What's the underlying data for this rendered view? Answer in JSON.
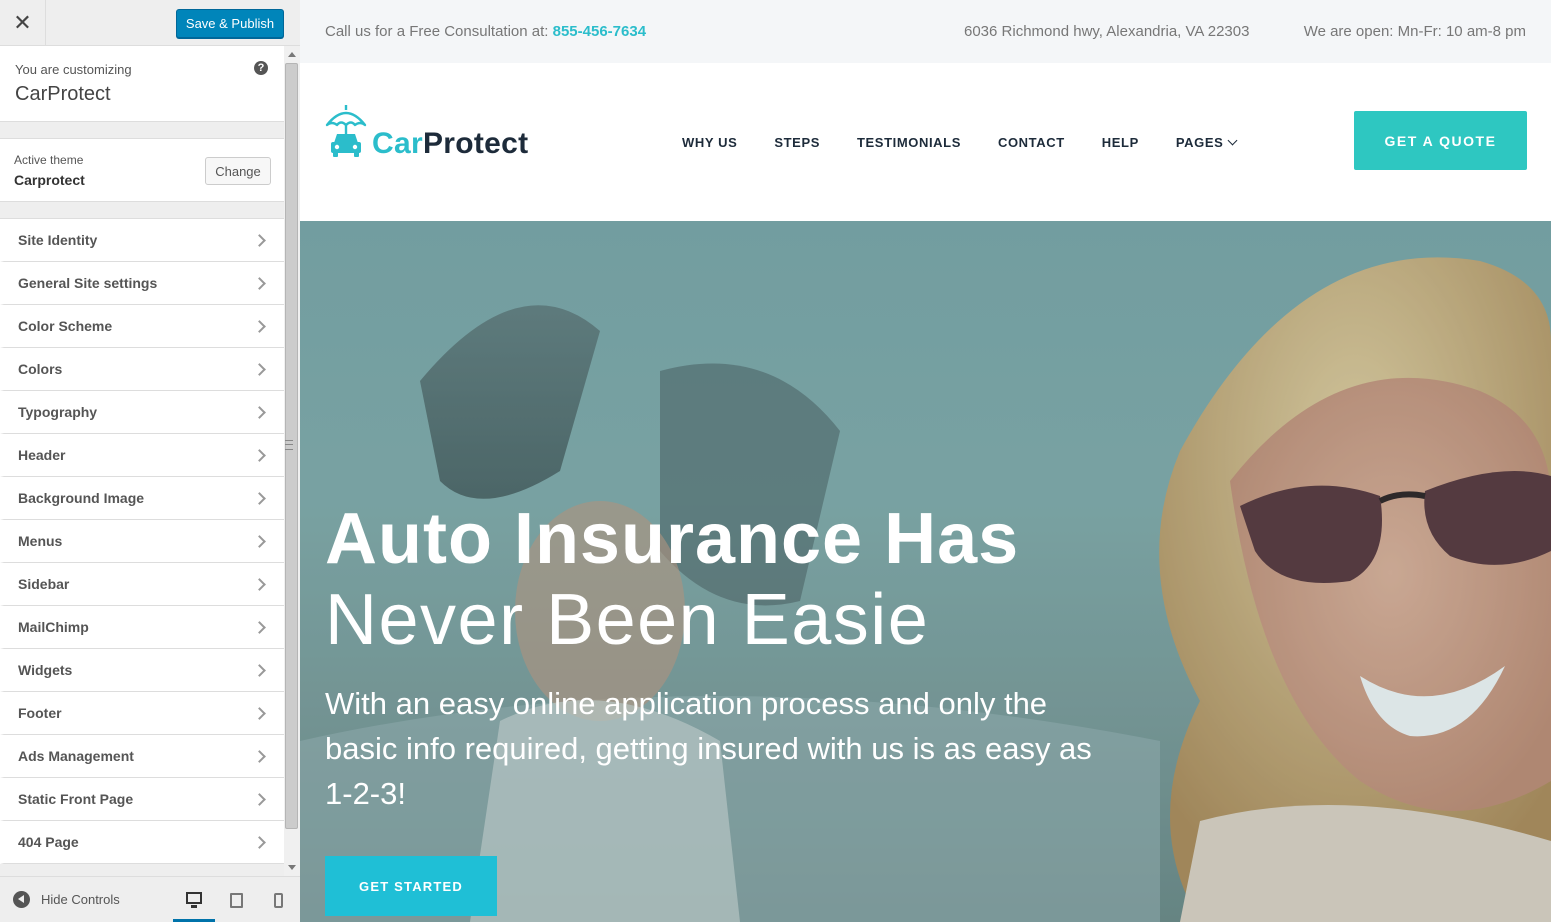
{
  "customizer": {
    "close_icon": "close-icon",
    "save_label": "Save & Publish",
    "info": {
      "prefix": "You are customizing",
      "site_name": "CarProtect",
      "help_glyph": "?"
    },
    "theme": {
      "label": "Active theme",
      "name": "Carprotect",
      "change_label": "Change"
    },
    "sections": [
      {
        "label": "Site Identity"
      },
      {
        "label": "General Site settings"
      },
      {
        "label": "Color Scheme"
      },
      {
        "label": "Colors"
      },
      {
        "label": "Typography"
      },
      {
        "label": "Header"
      },
      {
        "label": "Background Image"
      },
      {
        "label": "Menus"
      },
      {
        "label": "Sidebar"
      },
      {
        "label": "MailChimp"
      },
      {
        "label": "Widgets"
      },
      {
        "label": "Footer"
      },
      {
        "label": "Ads Management"
      },
      {
        "label": "Static Front Page"
      },
      {
        "label": "404 Page"
      }
    ],
    "footer": {
      "hide_label": "Hide Controls",
      "active_device": "desktop"
    }
  },
  "site": {
    "topbar": {
      "call_text": "Call us for a Free Consultation at:",
      "phone": "855-456-7634",
      "address": "6036 Richmond hwy, Alexandria, VA 22303",
      "hours": "We are open: Mn-Fr: 10 am-8 pm"
    },
    "logo": {
      "part1": "Car",
      "part2": "Protect"
    },
    "menu": [
      {
        "label": "WHY US"
      },
      {
        "label": "STEPS"
      },
      {
        "label": "TESTIMONIALS"
      },
      {
        "label": "CONTACT"
      },
      {
        "label": "HELP"
      },
      {
        "label": "PAGES"
      }
    ],
    "quote_label": "GET A QUOTE",
    "hero": {
      "title_bold": "Auto Insurance Has",
      "title_light": "Never Been Easie",
      "paragraph": "With an easy online application process and only the basic info required, getting insured with us is as easy as 1-2-3!",
      "cta_label": "GET STARTED"
    }
  },
  "colors": {
    "wp_primary": "#0085ba",
    "brand_teal": "#2bbdcb",
    "quote_button": "#2ec7c1",
    "hero_button": "#1fbfd6",
    "navy": "#1d2b3a"
  }
}
